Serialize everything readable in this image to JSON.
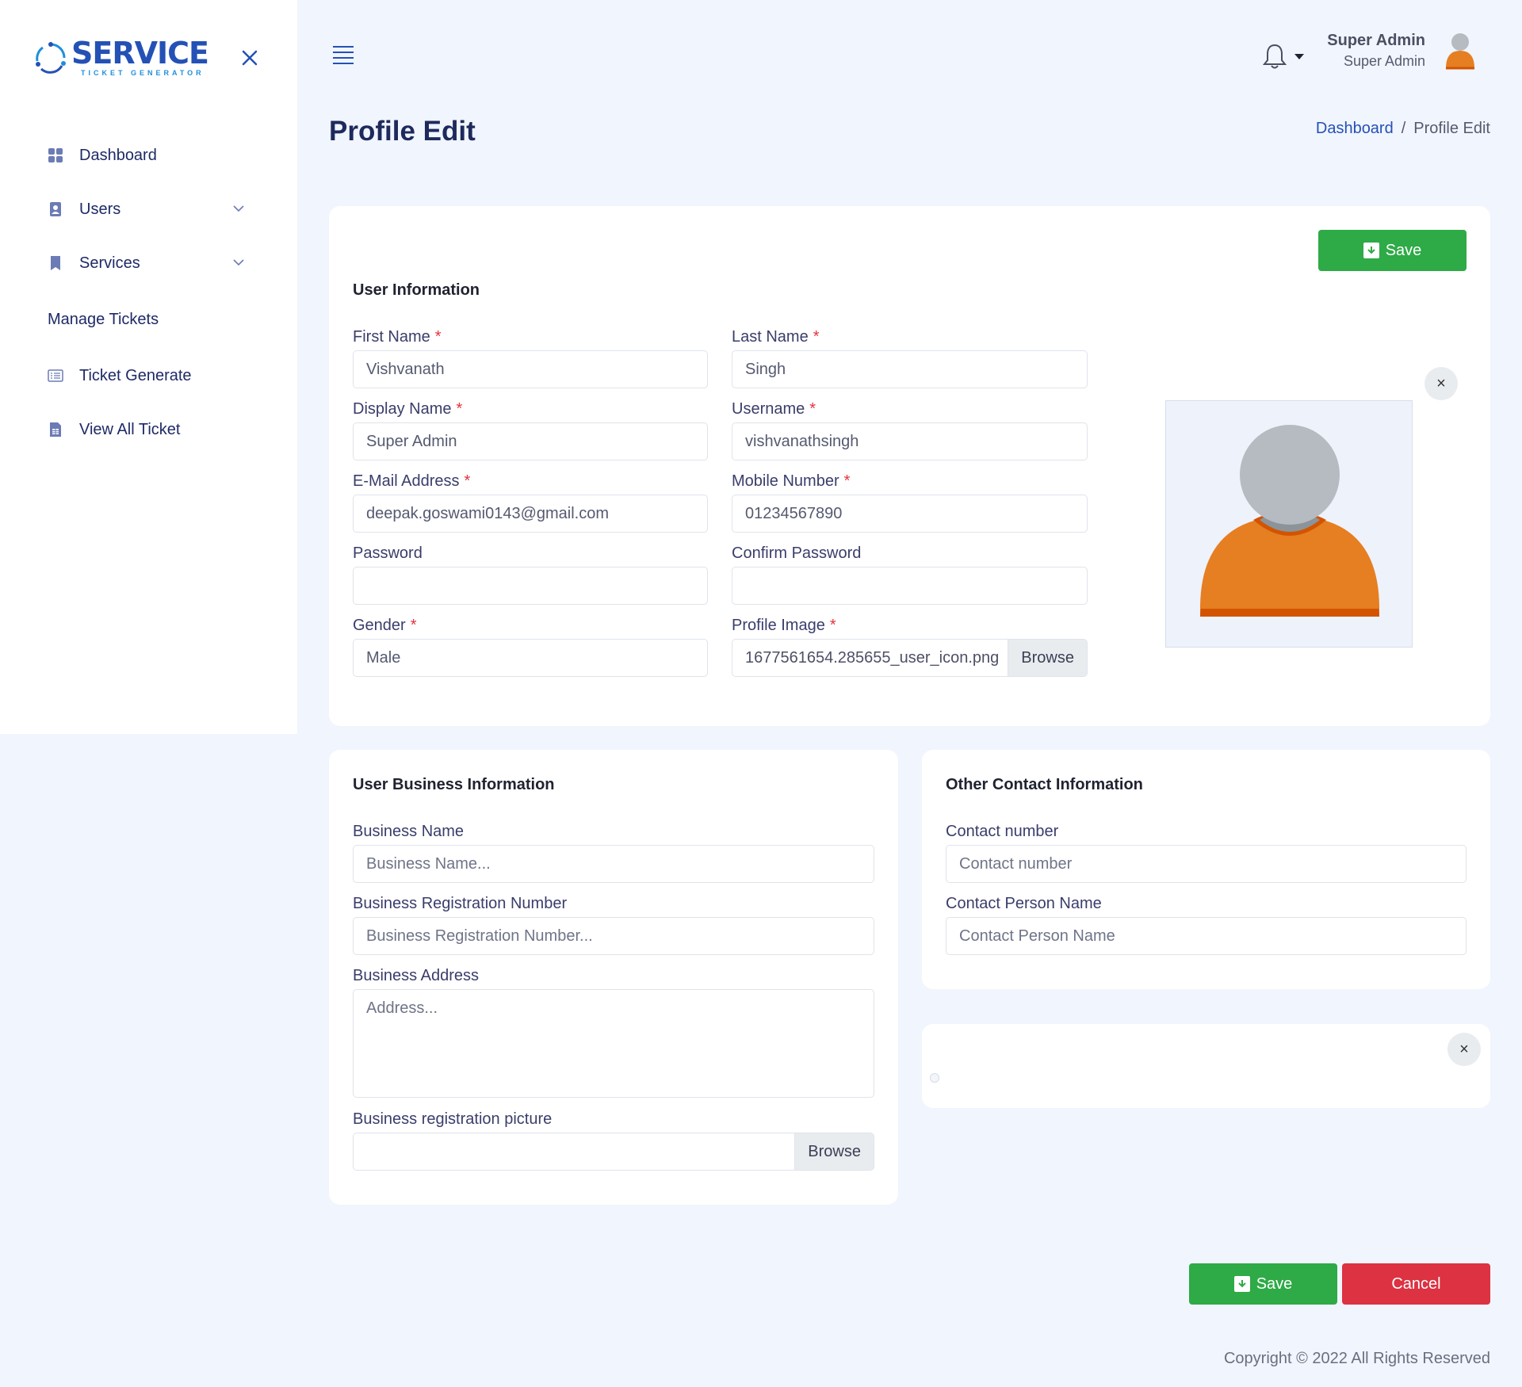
{
  "brand": {
    "name": "SERVICE",
    "tagline": "TICKET GENERATOR",
    "colors": {
      "primary": "#2451b5",
      "accent": "#1f8fdd"
    }
  },
  "sidebar": {
    "items": [
      {
        "label": "Dashboard",
        "icon": "grid-icon"
      },
      {
        "label": "Users",
        "icon": "user-badge-icon",
        "has_dropdown": true
      },
      {
        "label": "Services",
        "icon": "bookmark-icon",
        "has_dropdown": true
      }
    ],
    "section": "Manage Tickets",
    "ticket_items": [
      {
        "label": "Ticket Generate",
        "icon": "list-card-icon"
      },
      {
        "label": "View All Ticket",
        "icon": "document-table-icon"
      }
    ]
  },
  "header": {
    "user_name": "Super Admin",
    "user_role": "Super Admin"
  },
  "page": {
    "title": "Profile Edit",
    "breadcrumb": {
      "home": "Dashboard",
      "separator": "/",
      "current": "Profile Edit"
    }
  },
  "user_info": {
    "title": "User Information",
    "save_label": "Save",
    "required_marker": "*",
    "first_name": {
      "label": "First Name",
      "value": "Vishvanath"
    },
    "last_name": {
      "label": "Last Name",
      "value": "Singh"
    },
    "display_name": {
      "label": "Display Name",
      "value": "Super Admin"
    },
    "username": {
      "label": "Username",
      "value": "vishvanathsingh"
    },
    "email": {
      "label": "E-Mail Address",
      "value": "deepak.goswami0143@gmail.com"
    },
    "mobile": {
      "label": "Mobile Number",
      "value": "01234567890"
    },
    "password": {
      "label": "Password",
      "value": ""
    },
    "confirm_password": {
      "label": "Confirm Password",
      "value": ""
    },
    "gender": {
      "label": "Gender",
      "value": "Male"
    },
    "profile_image": {
      "label": "Profile Image",
      "file": "1677561654.285655_user_icon.png",
      "browse": "Browse"
    },
    "remove_symbol": "×"
  },
  "business_info": {
    "title": "User Business Information",
    "business_name": {
      "label": "Business Name",
      "placeholder": "Business Name..."
    },
    "registration_number": {
      "label": "Business Registration Number",
      "placeholder": "Business Registration Number..."
    },
    "address": {
      "label": "Business Address",
      "placeholder": "Address..."
    },
    "registration_picture": {
      "label": "Business registration picture",
      "browse": "Browse"
    }
  },
  "contact_info": {
    "title": "Other Contact Information",
    "contact_number": {
      "label": "Contact number",
      "placeholder": "Contact number"
    },
    "contact_person": {
      "label": "Contact Person Name",
      "placeholder": "Contact Person Name"
    }
  },
  "empty_panel": {
    "remove_symbol": "×"
  },
  "footer_actions": {
    "save_label": "Save",
    "cancel_label": "Cancel"
  },
  "copyright": "Copyright © 2022 All Rights Reserved",
  "colors": {
    "save": "#2eaa47",
    "cancel": "#dc3242",
    "background": "#f1f5fd",
    "avatar_body": "#e67e22",
    "avatar_head": "#b5bbc0"
  }
}
